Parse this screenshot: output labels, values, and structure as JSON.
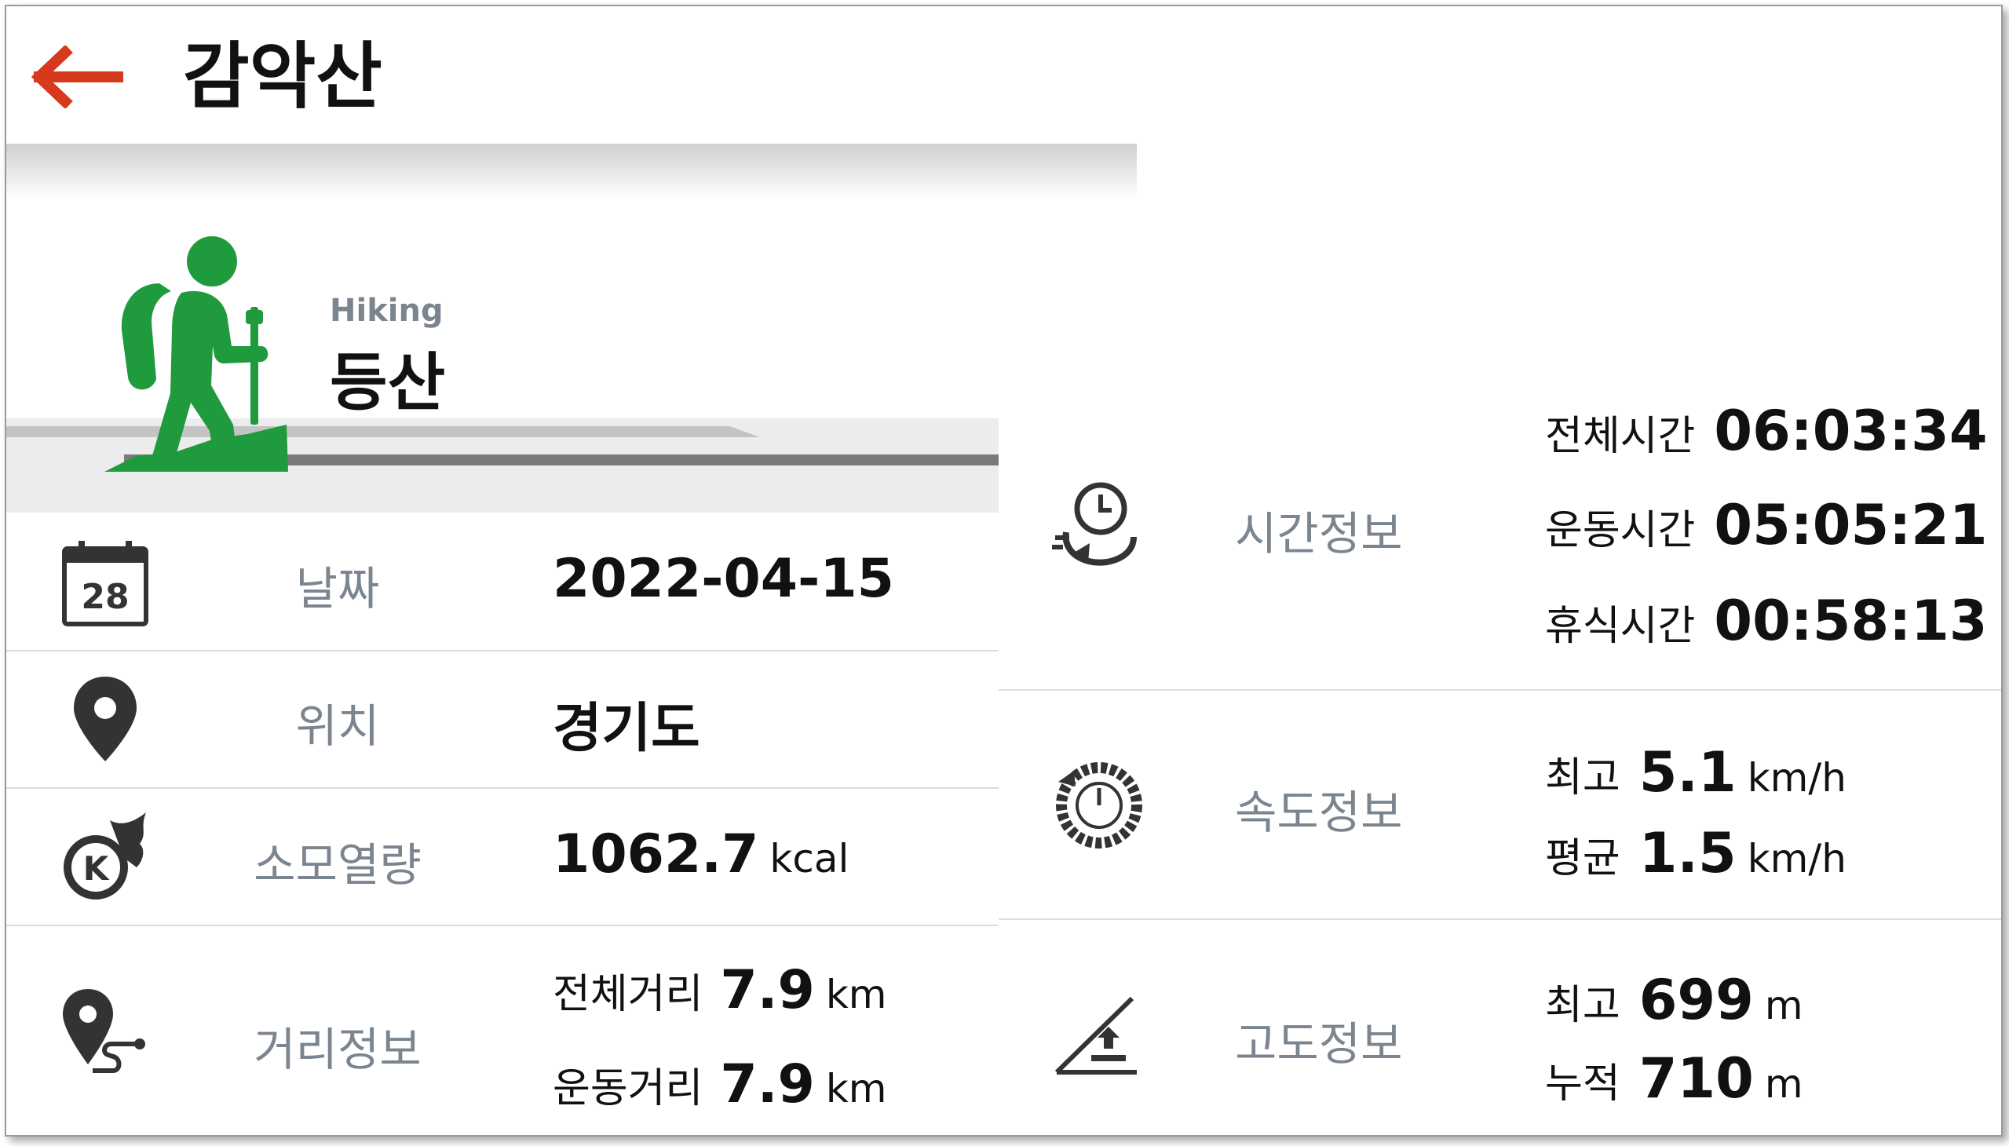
{
  "header": {
    "title": "감악산",
    "back_icon": "back-arrow-icon",
    "accent_color": "#d6391b"
  },
  "activity": {
    "subtitle": "Hiking",
    "title": "등산",
    "icon": "hiker-icon",
    "icon_color": "#1f9a3c"
  },
  "left_rows": {
    "date": {
      "label": "날짜",
      "value": "2022-04-15",
      "icon": "calendar-icon",
      "calendar_day": "28"
    },
    "location": {
      "label": "위치",
      "value": "경기도",
      "icon": "location-pin-icon"
    },
    "calories": {
      "label": "소모열량",
      "value": "1062.7",
      "unit": "kcal",
      "icon": "calorie-fire-icon",
      "icon_letter": "K"
    },
    "distance": {
      "label": "거리정보",
      "icon": "route-pin-icon",
      "total_label": "전체거리",
      "total_value": "7.9",
      "total_unit": "km",
      "moving_label": "운동거리",
      "moving_value": "7.9",
      "moving_unit": "km"
    }
  },
  "right_rows": {
    "time": {
      "label": "시간정보",
      "icon": "clock-refresh-icon",
      "total_label": "전체시간",
      "total_value": "06:03:34",
      "moving_label": "운동시간",
      "moving_value": "05:05:21",
      "rest_label": "휴식시간",
      "rest_value": "00:58:13"
    },
    "speed": {
      "label": "속도정보",
      "icon": "speedometer-icon",
      "max_label": "최고",
      "max_value": "5.1",
      "max_unit": "km/h",
      "avg_label": "평균",
      "avg_value": "1.5",
      "avg_unit": "km/h"
    },
    "altitude": {
      "label": "고도정보",
      "icon": "altitude-slope-icon",
      "max_label": "최고",
      "max_value": "699",
      "max_unit": "m",
      "cum_label": "누적",
      "cum_value": "710",
      "cum_unit": "m"
    }
  }
}
